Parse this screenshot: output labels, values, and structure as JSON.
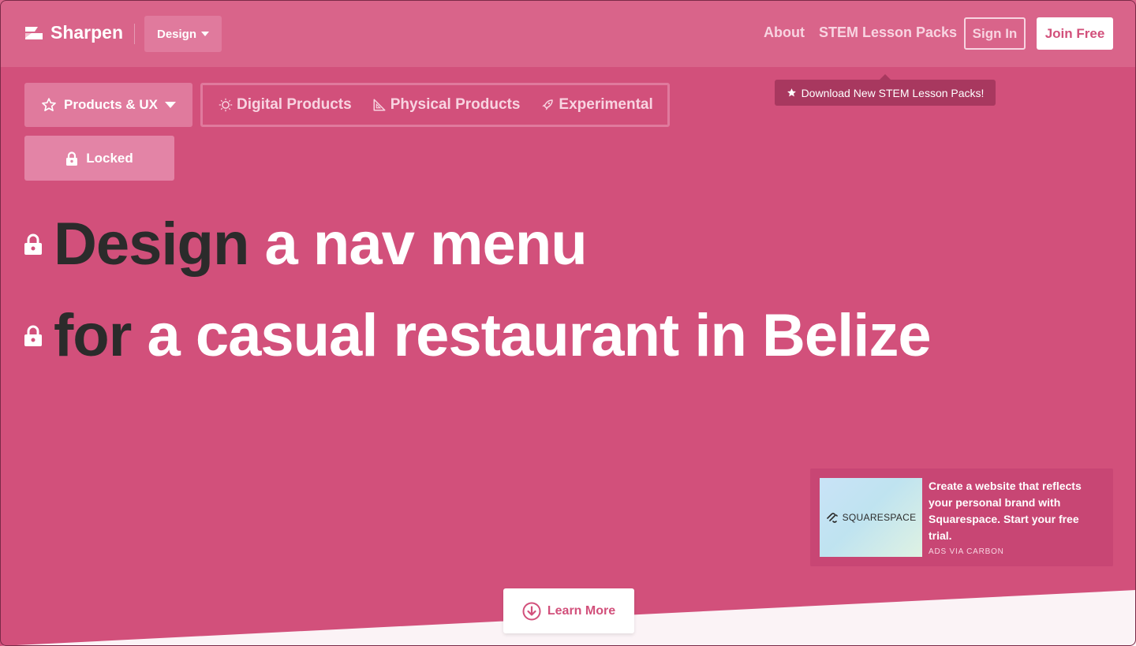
{
  "brand": {
    "name": "Sharpen"
  },
  "topnav": {
    "category_dropdown": "Design",
    "about": "About",
    "stem": "STEM Lesson Packs",
    "signin": "Sign In",
    "joinfree": "Join Free"
  },
  "tooltip": {
    "text": "Download New STEM Lesson Packs!"
  },
  "filters": {
    "category": "Products & UX",
    "subcategories": [
      "Digital Products",
      "Physical Products",
      "Experimental"
    ],
    "locked": "Locked"
  },
  "headline": {
    "line1_word": "Design",
    "line1_rest": "a nav menu",
    "line2_word": "for",
    "line2_rest": "a casual restaurant in Belize"
  },
  "ad": {
    "brand": "SQUARESPACE",
    "text": "Create a website that reflects your personal brand with Squarespace. Start your free trial.",
    "via": "ADS VIA CARBON"
  },
  "cta": {
    "learn_more": "Learn More"
  },
  "colors": {
    "background": "#d2507b",
    "navbar": "#d9648a",
    "tooltip": "#a8385f",
    "dark_text": "#2b2b2b"
  }
}
